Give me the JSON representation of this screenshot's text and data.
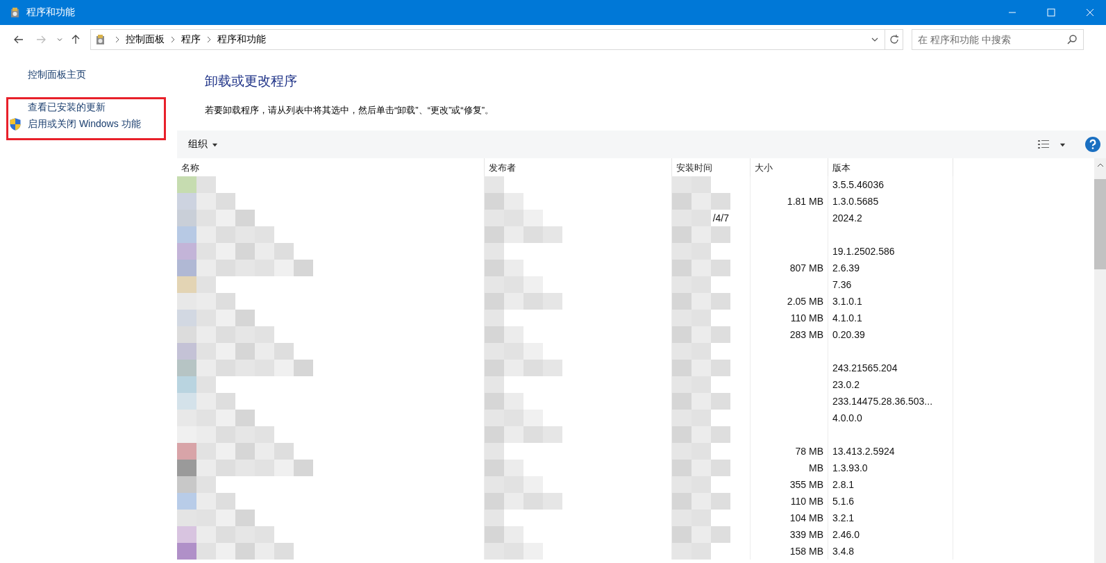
{
  "window": {
    "title": "程序和功能"
  },
  "nav": {
    "breadcrumb": [
      "控制面板",
      "程序",
      "程序和功能"
    ],
    "search": {
      "placeholder": "在 程序和功能 中搜索"
    }
  },
  "sidebar": {
    "items": [
      {
        "label": "控制面板主页",
        "kind": "link",
        "highlighted": false
      },
      {
        "label": "查看已安装的更新",
        "kind": "link",
        "highlighted": true
      },
      {
        "label": "启用或关闭 Windows 功能",
        "kind": "shield-link",
        "highlighted": true
      }
    ]
  },
  "main": {
    "heading": "卸载或更改程序",
    "description": "若要卸载程序，请从列表中将其选中，然后单击“卸载”、“更改”或“修复”。",
    "toolbar": {
      "organize": "组织"
    },
    "table": {
      "columns": [
        "名称",
        "发布者",
        "安装时间",
        "大小",
        "版本"
      ],
      "rows": [
        {
          "version": "3.5.5.46036"
        },
        {
          "size": "1.81 MB",
          "version": "1.3.0.5685"
        },
        {
          "date": "/4/7",
          "version": "2024.2"
        },
        {},
        {
          "version": "19.1.2502.586"
        },
        {
          "size": "807 MB",
          "version": "2.6.39"
        },
        {
          "version": "7.36"
        },
        {
          "size": "2.05 MB",
          "version": "3.1.0.1"
        },
        {
          "size": "110 MB",
          "version": "4.1.0.1"
        },
        {
          "size": "283 MB",
          "version": "0.20.39"
        },
        {},
        {
          "version": "243.21565.204"
        },
        {
          "version": "23.0.2"
        },
        {
          "version": "233.14475.28.36.503..."
        },
        {
          "version": "4.0.0.0"
        },
        {},
        {
          "size": "78 MB",
          "version": "13.413.2.5924"
        },
        {
          "size": "MB",
          "version": "1.3.93.0"
        },
        {
          "size": "355 MB",
          "version": "2.8.1"
        },
        {
          "size": "110 MB",
          "version": "5.1.6"
        },
        {
          "size": "104 MB",
          "version": "3.2.1"
        },
        {
          "size": "339 MB",
          "version": "2.46.0"
        },
        {
          "size": "158 MB",
          "version": "3.4.8"
        }
      ]
    }
  }
}
